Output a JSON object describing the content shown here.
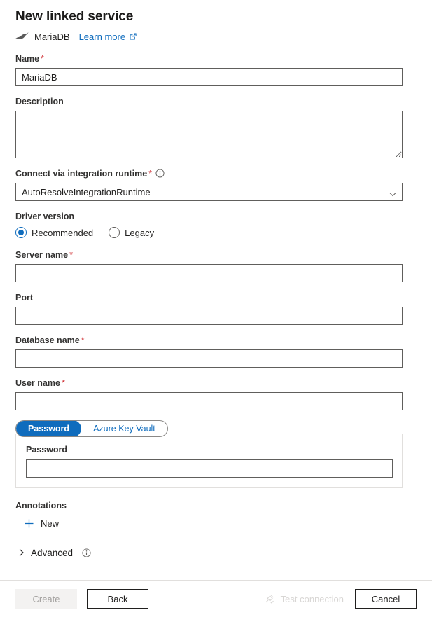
{
  "header": {
    "title": "New linked service",
    "service_name": "MariaDB",
    "logo_icon": "mariadb-seal-logo",
    "learn_more_label": "Learn more",
    "external_link_icon": "external-link-icon"
  },
  "form": {
    "name": {
      "label": "Name",
      "required": true,
      "value": "MariaDB",
      "placeholder": ""
    },
    "description": {
      "label": "Description",
      "required": false,
      "value": "",
      "placeholder": ""
    },
    "integration_runtime": {
      "label": "Connect via integration runtime",
      "required": true,
      "info_icon": "info-icon",
      "value": "AutoResolveIntegrationRuntime",
      "options": [
        "AutoResolveIntegrationRuntime"
      ],
      "chevron_icon": "chevron-down-icon"
    },
    "driver_version": {
      "label": "Driver version",
      "selected": "Recommended",
      "options": [
        {
          "label": "Recommended",
          "selected": true
        },
        {
          "label": "Legacy",
          "selected": false
        }
      ]
    },
    "server_name": {
      "label": "Server name",
      "required": true,
      "value": "",
      "placeholder": ""
    },
    "port": {
      "label": "Port",
      "required": false,
      "value": "",
      "placeholder": ""
    },
    "database_name": {
      "label": "Database name",
      "required": true,
      "value": "",
      "placeholder": ""
    },
    "user_name": {
      "label": "User name",
      "required": true,
      "value": "",
      "placeholder": ""
    },
    "auth_pivot": {
      "tabs": [
        {
          "label": "Password",
          "active": true
        },
        {
          "label": "Azure Key Vault",
          "active": false
        }
      ],
      "password_field": {
        "label": "Password",
        "value": "",
        "placeholder": ""
      }
    },
    "annotations": {
      "label": "Annotations",
      "new_label": "New",
      "plus_icon": "plus-icon"
    },
    "advanced": {
      "label": "Advanced",
      "expanded": false,
      "chevron_icon": "chevron-right-icon",
      "info_icon": "info-icon"
    }
  },
  "footer": {
    "create_label": "Create",
    "create_disabled": true,
    "back_label": "Back",
    "test_connection_label": "Test connection",
    "test_connection_disabled": true,
    "test_connection_icon": "plug-check-icon",
    "cancel_label": "Cancel"
  },
  "colors": {
    "accent": "#0f6cbd",
    "required_asterisk": "#d13438",
    "text": "#201f1e",
    "border": "#605e5c",
    "disabled_text": "#a19f9d"
  }
}
